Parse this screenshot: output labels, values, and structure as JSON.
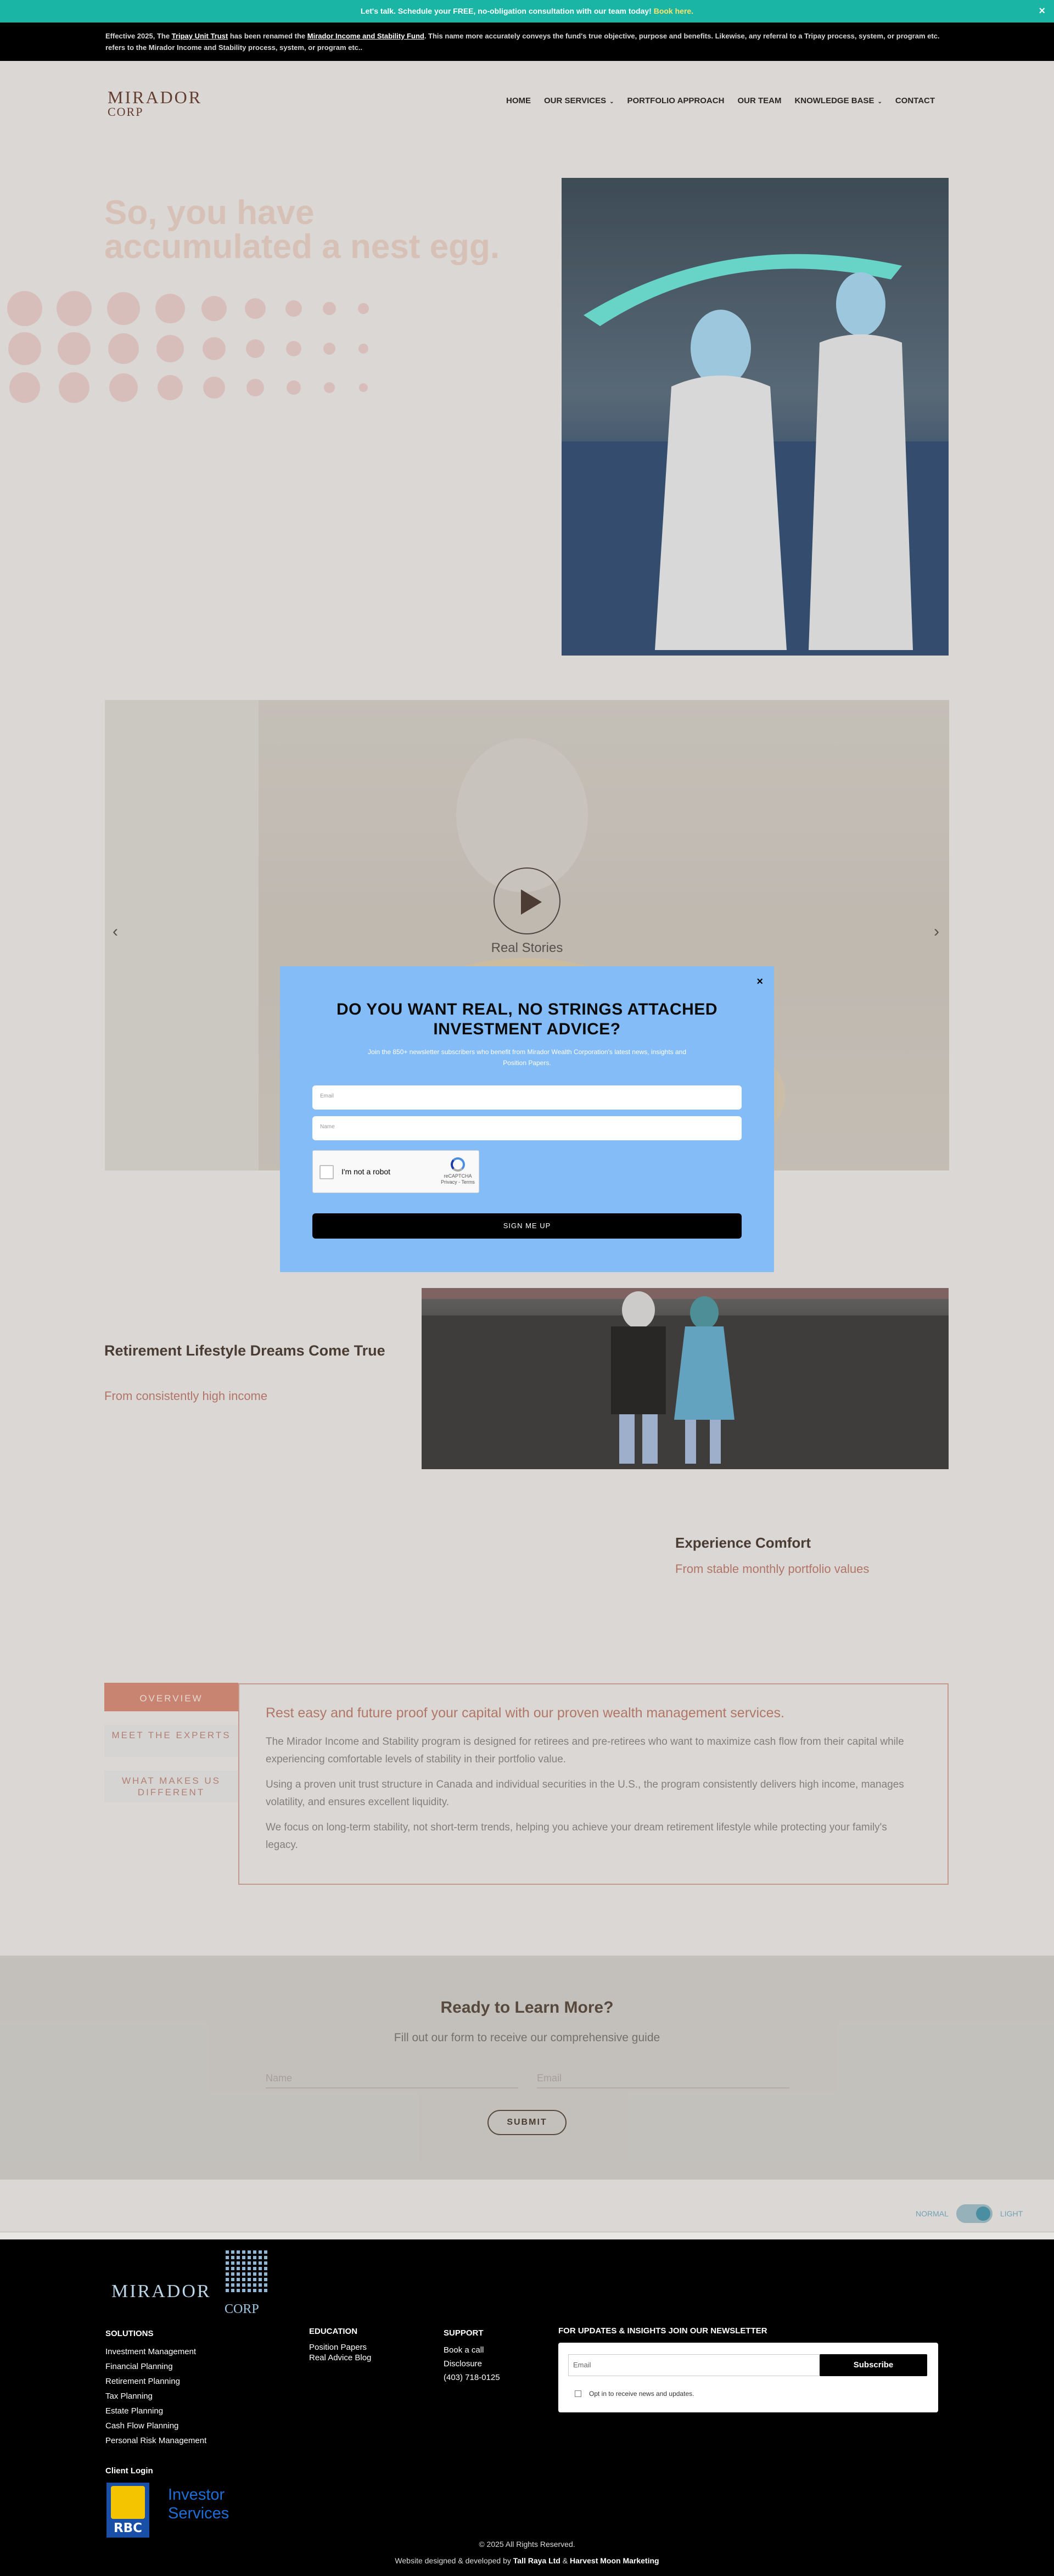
{
  "topbar": {
    "lead": "Let's talk. Schedule your FREE, no-obligation consultation with our team today!",
    "link": "Book here.",
    "close": "×"
  },
  "notice": {
    "p1": "Effective 2025,  The ",
    "old_name": "Tripay Unit Trust",
    "p2": " has been renamed the ",
    "new_name": "Mirador Income and Stability Fund",
    "p3": ".  This name more accurately conveys the fund's true objective, purpose and benefits. Likewise, any referral to a Tripay process, system, or program etc. refers to the Mirador Income and Stability process, system, or program etc.."
  },
  "header": {
    "logo_line1": "MIRADOR",
    "logo_line2": "CORP",
    "nav": [
      {
        "label": "HOME"
      },
      {
        "label": "OUR SERVICES",
        "caret": "⌄"
      },
      {
        "label": "PORTFOLIO APPROACH"
      },
      {
        "label": "OUR TEAM"
      },
      {
        "label": "KNOWLEDGE BASE",
        "caret": "⌄"
      },
      {
        "label": "CONTACT"
      }
    ]
  },
  "hero": {
    "title": "So, you have accumulated a nest egg."
  },
  "video": {
    "caption": "Real Stories",
    "prev": "‹",
    "next": "›"
  },
  "lifestyle": {
    "title": "Retirement Lifestyle Dreams Come True",
    "subtitle": "From consistently high income"
  },
  "comfort": {
    "title": "Experience Comfort",
    "subtitle": "From stable monthly portfolio values"
  },
  "tabs": [
    {
      "label": "OVERVIEW"
    },
    {
      "label": "MEET THE EXPERTS"
    },
    {
      "label": "WHAT MAKES US DIFFERENT"
    }
  ],
  "panel": {
    "heading": "Rest easy and future proof your capital with our proven wealth management services.",
    "paragraphs": [
      "The Mirador Income and Stability program is designed for retirees and pre-retirees who want to maximize cash flow from their capital while experiencing comfortable levels of stability in their portfolio value.",
      "Using a proven unit trust structure in Canada and individual securities in the U.S., the program consistently delivers high income, manages volatility, and ensures excellent liquidity.",
      "We focus on long-term stability, not short-term trends, helping you achieve your dream retirement lifestyle while protecting your family's legacy."
    ]
  },
  "learn": {
    "title": "Ready to Learn More?",
    "subtitle": "Fill out our form to receive our comprehensive guide",
    "name_placeholder": "Name",
    "email_placeholder": "Email",
    "submit": "SUBMIT"
  },
  "mode_toggle": {
    "left": "NORMAL",
    "right": "LIGHT"
  },
  "footer": {
    "logo_name": "MIRADOR",
    "logo_corp": "CORP",
    "solutions": {
      "title": "SOLUTIONS",
      "items": [
        "Investment Management",
        "Financial Planning",
        "Retirement Planning",
        "Tax Planning",
        "Estate Planning",
        "Cash Flow Planning",
        "Personal Risk Management"
      ]
    },
    "education": {
      "title": "EDUCATION",
      "items": [
        "Position Papers",
        "Real Advice Blog"
      ]
    },
    "support": {
      "title": "SUPPORT",
      "items": [
        "Book a call",
        "Disclosure",
        "(403) 718-0125"
      ]
    },
    "newsletter": {
      "title": "FOR UPDATES & INSIGHTS JOIN OUR NEWSLETTER",
      "placeholder": "Email",
      "button": "Subscribe",
      "optin": "Opt in to receive news and updates."
    },
    "client_login": "Client Login",
    "rbc": "RBC",
    "investor_line1": "Investor",
    "investor_line2": "Services",
    "copyright": "© 2025 All Rights Reserved.",
    "credit_prefix": "Website designed & developed by ",
    "credit_firm1": "Tall Raya Ltd",
    "credit_amp": " & ",
    "credit_firm2": "Harvest Moon Marketing"
  },
  "modal": {
    "close": "×",
    "title": "DO YOU WANT REAL, NO STRINGS ATTACHED INVESTMENT ADVICE?",
    "subtitle": "Join the 850+ newsletter subscribers who benefit from Mirador Wealth Corporation's latest news, insights and Position Papers.",
    "email_placeholder": "Email",
    "name_placeholder": "Name",
    "captcha_label": "I'm not a robot",
    "captcha_brand": "reCAPTCHA",
    "captcha_links": "Privacy - Terms",
    "button": "SIGN ME UP"
  },
  "colors": {
    "topbar": "#1bb5a5",
    "accent": "#d4826b",
    "modal": "#84bcf7",
    "footer": "#000000"
  }
}
